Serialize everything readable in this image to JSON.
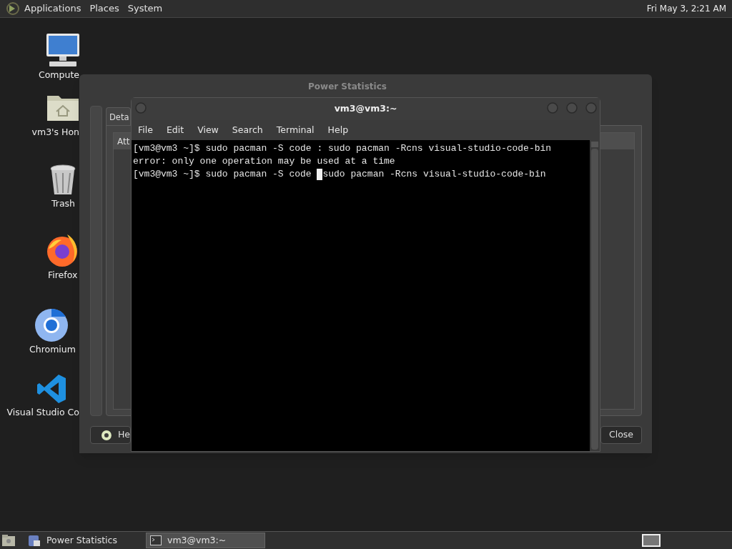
{
  "top_panel": {
    "menus": [
      "Applications",
      "Places",
      "System"
    ],
    "clock": "Fri May 3, 2:21 AM"
  },
  "desktop_icons": [
    {
      "kind": "computer",
      "label": "Compute"
    },
    {
      "kind": "home",
      "label": "vm3's Hon"
    },
    {
      "kind": "trash",
      "label": "Trash"
    },
    {
      "kind": "firefox",
      "label": "Firefox"
    },
    {
      "kind": "chromium",
      "label": "Chromium"
    },
    {
      "kind": "vscode",
      "label": "Visual Studio Co"
    }
  ],
  "power_window": {
    "title": "Power Statistics",
    "tabs": [
      {
        "label": "Deta",
        "selected": true
      }
    ],
    "table": {
      "columns": [
        "Att"
      ]
    },
    "help_button": "He",
    "close_button": "Close"
  },
  "terminal_window": {
    "title": "vm3@vm3:~",
    "menu": [
      "File",
      "Edit",
      "View",
      "Search",
      "Terminal",
      "Help"
    ],
    "lines": [
      {
        "kind": "text",
        "text": "[vm3@vm3 ~]$ sudo pacman -S code : sudo pacman -Rcns visual-studio-code-bin"
      },
      {
        "kind": "text",
        "text": "error: only one operation may be used at a time"
      },
      {
        "kind": "cursor_line",
        "before": "[vm3@vm3 ~]$ sudo pacman -S code ",
        "after": "sudo pacman -Rcns visual-studio-code-bin"
      }
    ]
  },
  "taskbar": {
    "tasks": [
      {
        "kind": "power",
        "label": "Power Statistics",
        "selected": false
      },
      {
        "kind": "terminal",
        "label": "vm3@vm3:~",
        "selected": true
      }
    ]
  }
}
